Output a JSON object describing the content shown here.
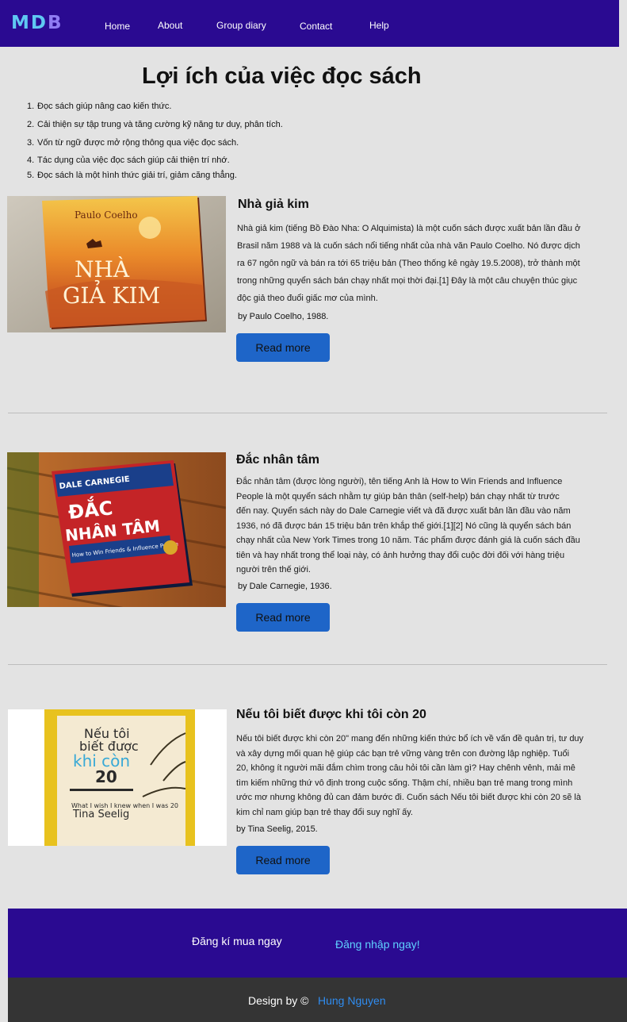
{
  "brand": {
    "letter_m": "M",
    "letter_d": "D",
    "letter_b": "B"
  },
  "nav": {
    "items": [
      {
        "label": "Home"
      },
      {
        "label": "About"
      },
      {
        "label": "Group diary"
      },
      {
        "label": "Contact"
      },
      {
        "label": "Help"
      }
    ]
  },
  "page": {
    "title": "Lợi ích của việc đọc sách",
    "benefits": [
      {
        "num": "1.",
        "text": "Đọc sách giúp nâng cao kiến thức."
      },
      {
        "num": "2.",
        "text": "Cải thiện sự tập trung và tăng cường kỹ năng tư duy, phân tích."
      },
      {
        "num": "3.",
        "text": "Vốn từ ngữ được mở rộng thông qua việc đọc sách."
      },
      {
        "num": "4.",
        "text": "Tác dụng của việc đọc sách giúp cải thiện trí nhớ."
      },
      {
        "num": "5.",
        "text": "Đọc sách là một hình thức giải trí, giảm căng thẳng."
      }
    ]
  },
  "books": [
    {
      "title": "Nhà giả kim",
      "cover_top": "Paulo Coelho",
      "cover_line1": "NHÀ",
      "cover_line2": "GIẢ KIM",
      "description_lines": [
        "Nhà giả kim (tiếng Bồ Đào Nha: O Alquimista) là một cuốn sách được xuất bản lần đầu ở",
        "Brasil năm 1988 và là cuốn sách nổi tiếng nhất của nhà văn Paulo Coelho. Nó được dịch",
        "ra 67 ngôn ngữ và bán ra tới 65 triệu bản (Theo thống kê ngày 19.5.2008), trở thành một",
        "trong những quyển sách bán chạy nhất mọi thời đại.[1] Đây là một câu chuyện thúc giục",
        "độc giả theo đuổi giấc mơ của mình."
      ],
      "author": "by Paulo Coelho, 1988.",
      "button_label": "Read more"
    },
    {
      "title": "Đắc nhân tâm",
      "cover_top": "DALE CARNEGIE",
      "cover_line1": "ĐẮC",
      "cover_line2": "NHÂN TÂM",
      "cover_sub": "How to Win Friends & Influence People",
      "description_lines": [
        "Đắc nhân tâm (được lòng người), tên tiếng Anh là How to Win Friends and Influence",
        "People là một quyển sách nhằm tự giúp bản thân (self-help) bán chạy nhất từ trước",
        "đến nay. Quyển sách này do Dale Carnegie viết và đã được xuất bản lần đầu vào năm",
        "1936, nó đã được bán 15 triệu bản trên khắp thế giới.[1][2] Nó cũng là quyển sách bán",
        "chạy nhất của New York Times trong 10 năm. Tác phẩm được đánh giá là cuốn sách đầu",
        "tiên và hay nhất trong thể loại này, có ảnh hưởng thay đổi cuộc đời đối với hàng triệu",
        "người trên thế giới."
      ],
      "author": "by Dale Carnegie, 1936.",
      "button_label": "Read more"
    },
    {
      "title": "Nếu tôi biết được khi tôi còn 20",
      "cover_line1": "Nếu tôi",
      "cover_line2": "biết được",
      "cover_line3": "khi còn",
      "cover_line4": "20",
      "cover_sub": "What I wish I knew when I was 20",
      "cover_author": "Tina Seelig",
      "description_lines": [
        "Nếu tôi biết được khi còn 20\" mang đến những kiến thức bổ ích về vấn đề quản trị, tư duy",
        "và xây dựng mối quan hệ giúp các bạn trẻ vững vàng trên con đường lập nghiệp. Tuổi",
        "20, không ít người mãi đắm chìm trong câu hỏi tôi cần làm gì? Hay chênh vênh, mải mê",
        "tìm kiếm những thứ vô định trong cuộc sống. Thậm chí, nhiều bạn trẻ mang trong mình",
        "ước mơ nhưng không đủ can đảm bước đi. Cuốn sách Nếu tôi biết được khi còn 20 sẽ là",
        "kim chỉ nam giúp bạn trẻ thay đổi suy nghĩ ấy."
      ],
      "author": "by Tina Seelig, 2015.",
      "button_label": "Read more"
    }
  ],
  "footer": {
    "cta_text": "Đăng kí mua ngay",
    "cta_link": "Đăng nhập ngay!",
    "credit_prefix": "Design by ©",
    "credit_name": "Hung Nguyen"
  },
  "colors": {
    "nav_bg": "#2a0a91",
    "button_bg": "#1e65c8",
    "page_bg": "#e3e3e3",
    "footer_dark": "#343434",
    "link": "#2f8cf0"
  }
}
